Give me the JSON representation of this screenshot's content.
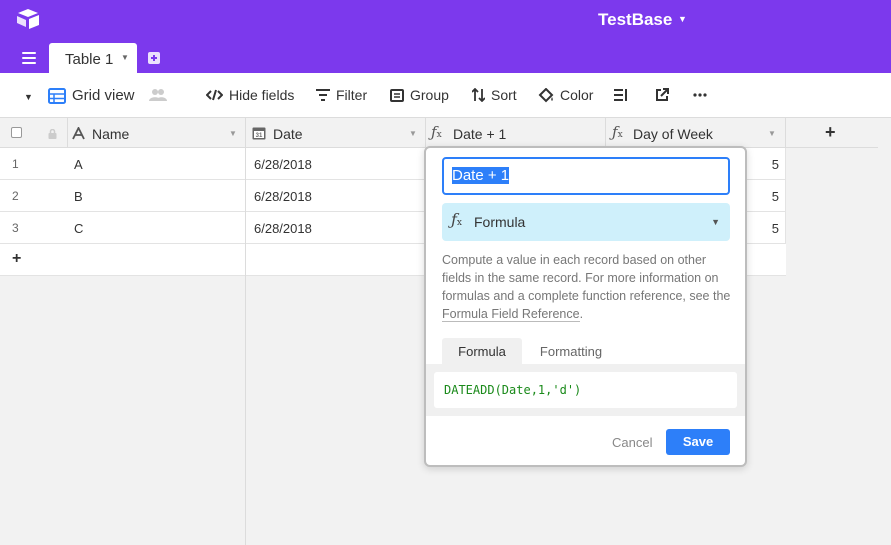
{
  "header": {
    "base_title": "TestBase",
    "active_table": "Table 1"
  },
  "toolbar": {
    "view_name": "Grid view",
    "hide_fields": "Hide fields",
    "filter": "Filter",
    "group": "Group",
    "sort": "Sort",
    "color": "Color"
  },
  "grid": {
    "columns": [
      {
        "label": "Name"
      },
      {
        "label": "Date"
      },
      {
        "label": "Date + 1"
      },
      {
        "label": "Day of Week"
      }
    ],
    "add_column": "+",
    "rows": [
      {
        "num": "1",
        "name": "A",
        "date": "6/28/2018",
        "dow": "5"
      },
      {
        "num": "2",
        "name": "B",
        "date": "6/28/2018",
        "dow": "5"
      },
      {
        "num": "3",
        "name": "C",
        "date": "6/28/2018",
        "dow": "5"
      }
    ],
    "add_row": "+"
  },
  "field_editor": {
    "field_name": "Date + 1",
    "field_type": "Formula",
    "description_before": "Compute a value in each record based on other fields in the same record. For more information on formulas and a complete function reference, see the ",
    "description_link": "Formula Field Reference",
    "description_after": ".",
    "tab_formula": "Formula",
    "tab_formatting": "Formatting",
    "formula": "DATEADD(Date,1,'d')",
    "cancel": "Cancel",
    "save": "Save"
  },
  "colors": {
    "header_bg": "#7c39ed",
    "accent_blue": "#2d7ff9",
    "type_select_bg": "#cff0fb",
    "formula_text": "#1a8a1a"
  }
}
